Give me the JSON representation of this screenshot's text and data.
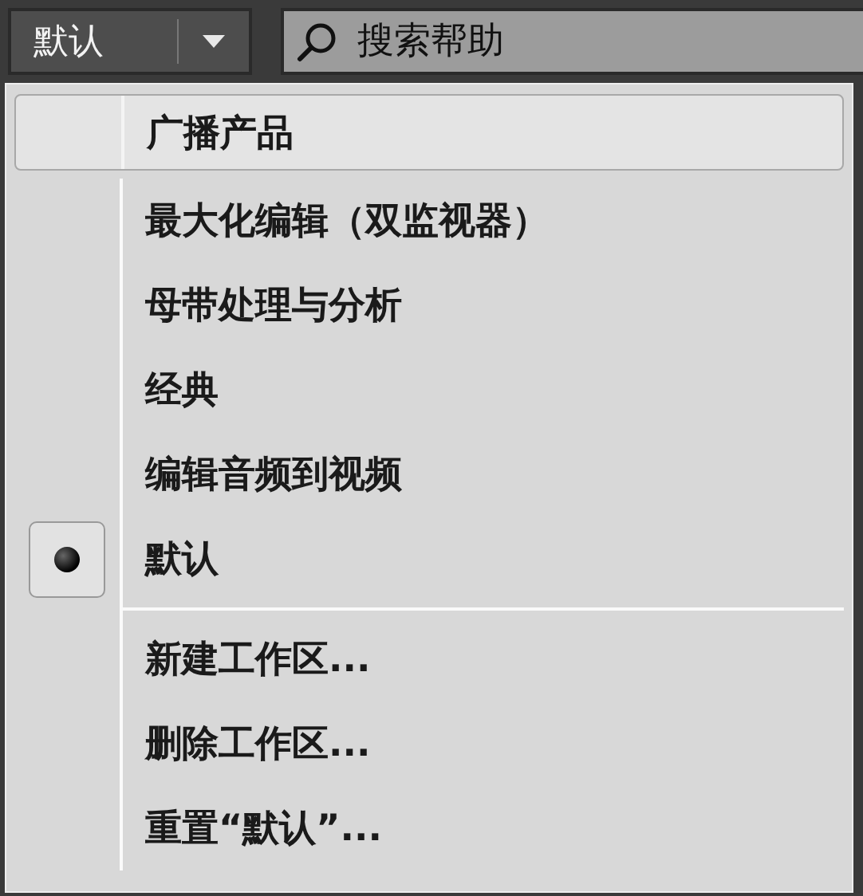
{
  "workspace_dropdown": {
    "value": "默认"
  },
  "search": {
    "placeholder": "搜索帮助"
  },
  "menu": {
    "items": [
      {
        "kind": "item",
        "label": "广播产品",
        "selected": false,
        "highlighted": true
      },
      {
        "kind": "item",
        "label": "最大化编辑（双监视器）",
        "selected": false,
        "highlighted": false
      },
      {
        "kind": "item",
        "label": "母带处理与分析",
        "selected": false,
        "highlighted": false
      },
      {
        "kind": "item",
        "label": "经典",
        "selected": false,
        "highlighted": false
      },
      {
        "kind": "item",
        "label": "编辑音频到视频",
        "selected": false,
        "highlighted": false
      },
      {
        "kind": "item",
        "label": "默认",
        "selected": true,
        "highlighted": false
      },
      {
        "kind": "separator"
      },
      {
        "kind": "item",
        "label": "新建工作区...",
        "selected": false,
        "highlighted": false
      },
      {
        "kind": "item",
        "label": "删除工作区...",
        "selected": false,
        "highlighted": false
      },
      {
        "kind": "item",
        "label": "重置“默认”...",
        "selected": false,
        "highlighted": false
      }
    ]
  }
}
